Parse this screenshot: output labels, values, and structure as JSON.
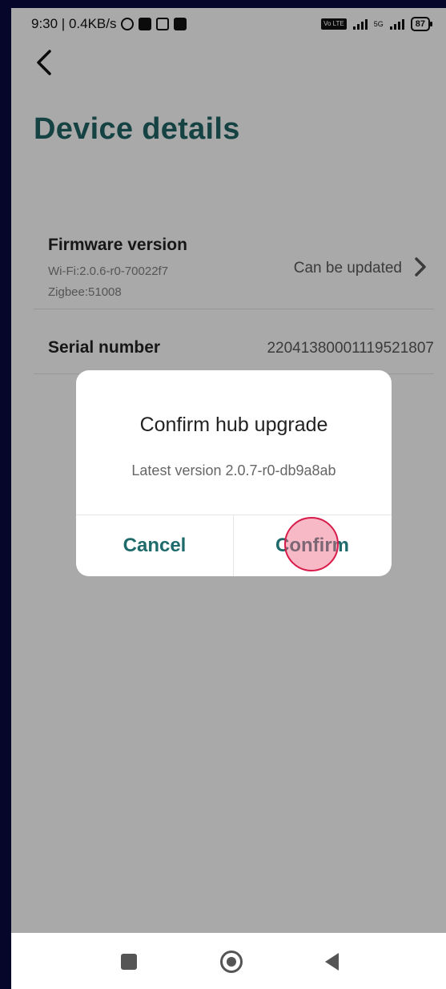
{
  "status_bar": {
    "time_speed": "9:30 | 0.4KB/s",
    "battery": "87",
    "network": "5G",
    "volte": "Vo LTE"
  },
  "header": {
    "title": "Device details",
    "back_icon": "chevron-left-icon"
  },
  "details": {
    "firmware": {
      "label": "Firmware version",
      "wifi": "Wi-Fi:2.0.6-r0-70022f7",
      "zigbee": "Zigbee:51008",
      "value": "Can be updated"
    },
    "serial": {
      "label": "Serial number",
      "value": "22041380001119521807"
    }
  },
  "dialog": {
    "title": "Confirm hub upgrade",
    "message": "Latest version 2.0.7-r0-db9a8ab",
    "cancel_label": "Cancel",
    "confirm_label": "Confirm"
  },
  "colors": {
    "accent": "#1f6b6b",
    "title": "#1f5f5f",
    "tap_marker": "#d81b49"
  }
}
